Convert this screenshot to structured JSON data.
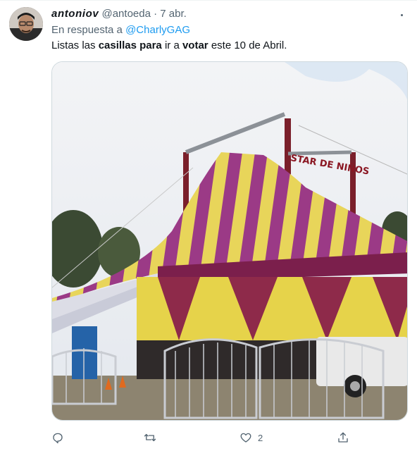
{
  "tweet": {
    "display_name": "antoniov",
    "handle": "@antoeda",
    "separator": "·",
    "date": "7 abr.",
    "reply_prefix": "En respuesta a",
    "reply_mention": "@CharlyGAG",
    "text_parts": [
      "Listas las ",
      "casillas",
      " ",
      "para",
      " ir a ",
      "votar",
      " este 10 de Abril."
    ],
    "image_sign_text": "STAR DE NIÑOS",
    "like_count": "2"
  },
  "icons": {
    "more": "more-horizontal-icon",
    "reply": "comment-icon",
    "retweet": "retweet-icon",
    "like": "heart-icon",
    "share": "share-icon"
  },
  "colors": {
    "accent": "#1d9bf0",
    "secondary_text": "#536471",
    "tent_purple": "#8e2a6f",
    "tent_yellow": "#e6d34a"
  }
}
